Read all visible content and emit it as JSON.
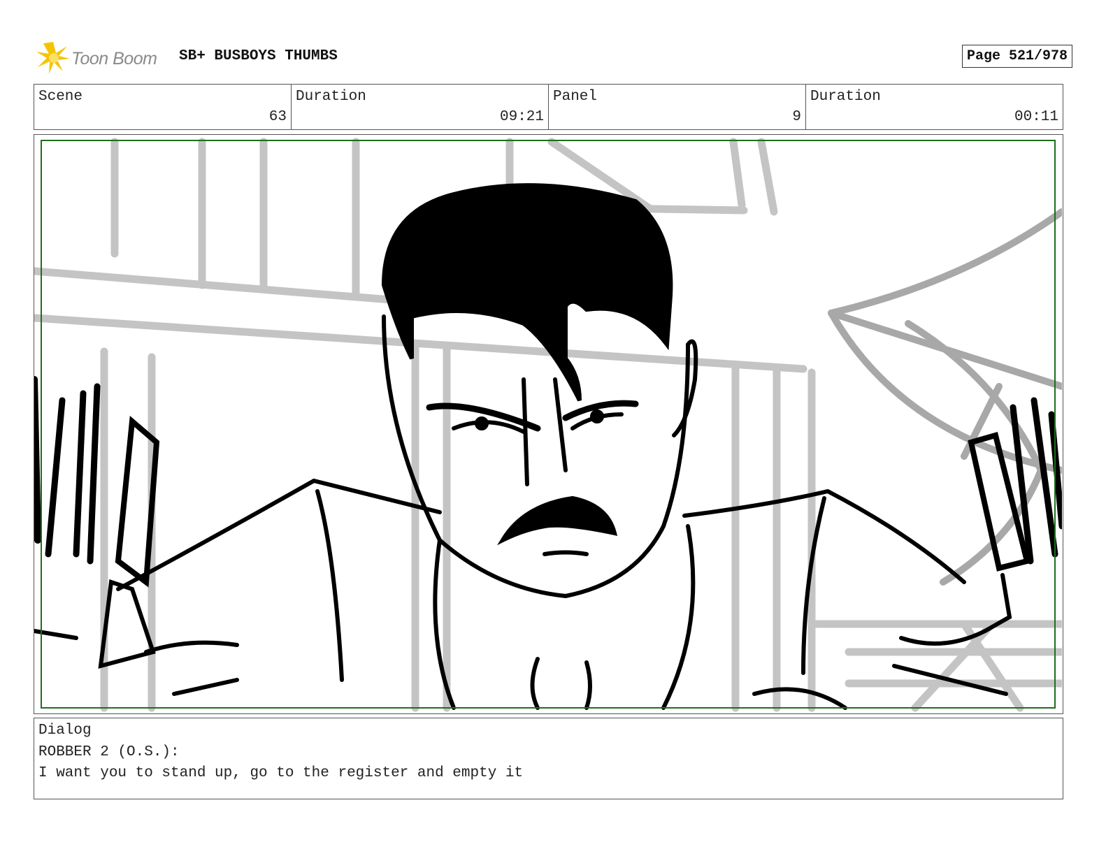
{
  "header": {
    "logo_text": "Toon Boom",
    "project_title": "SB+ BUSBOYS THUMBS",
    "page_label": "Page 521/978"
  },
  "info": {
    "scene_label": "Scene",
    "scene_value": "63",
    "scene_duration_label": "Duration",
    "scene_duration_value": "09:21",
    "panel_label": "Panel",
    "panel_value": "9",
    "panel_duration_label": "Duration",
    "panel_duration_value": "00:11"
  },
  "dialog": {
    "label": "Dialog",
    "speaker": "ROBBER 2 (O.S.):",
    "line": "I want you to stand up, go to the register and empty it"
  },
  "colors": {
    "safe_frame": "#1f6e1f",
    "sketch_gray": "#c4c4c4",
    "ink": "#000000",
    "logo_yellow": "#f5c400"
  }
}
